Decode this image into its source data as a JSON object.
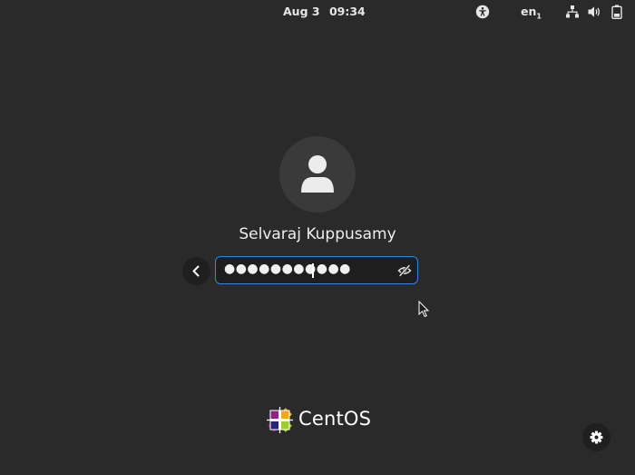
{
  "topbar": {
    "date": "Aug 3",
    "time": "09:34",
    "language": "en",
    "language_sub": "1",
    "icons": [
      "accessibility-icon",
      "network-icon",
      "volume-icon",
      "battery-icon"
    ]
  },
  "login": {
    "username": "Selvaraj Kuppusamy",
    "password_mask": "●●●●●●●●●●●",
    "back_icon": "chevron-left-icon",
    "reveal_icon": "eye-slash-icon",
    "focus_color": "#3584e4"
  },
  "branding": {
    "logo_text": "CentOS"
  },
  "footer": {
    "settings_icon": "gear-icon"
  },
  "colors": {
    "background": "#2a2a2a",
    "accent": "#3584e4"
  }
}
